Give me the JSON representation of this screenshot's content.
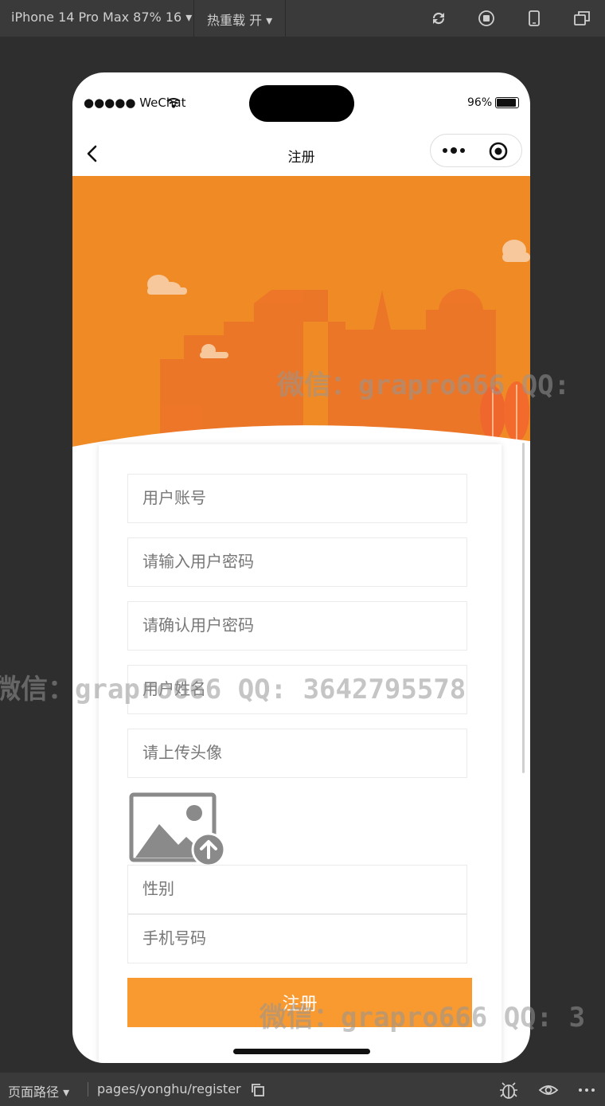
{
  "devtools": {
    "device": "iPhone 14 Pro Max 87% 16 ▾",
    "hot_reload": "热重载 开 ▾",
    "path_label": "页面路径 ▾",
    "path": "pages/yonghu/register"
  },
  "status": {
    "carrier": "●●●●● WeChat",
    "battery": "96%"
  },
  "nav": {
    "title": "注册"
  },
  "form": {
    "account_placeholder": "用户账号",
    "password_placeholder": "请输入用户密码",
    "confirm_placeholder": "请确认用户密码",
    "name_placeholder": "用户姓名",
    "avatar_placeholder": "请上传头像",
    "gender_placeholder": "性别",
    "phone_placeholder": "手机号码",
    "submit_label": "注册"
  },
  "watermarks": [
    "微信：grapro666 QQ:",
    "微信：grapro666 QQ: 3642795578",
    "微信：grapro666 QQ: 3"
  ],
  "colors": {
    "banner_orange": "#ef8a25",
    "button_orange": "#f99a31"
  }
}
